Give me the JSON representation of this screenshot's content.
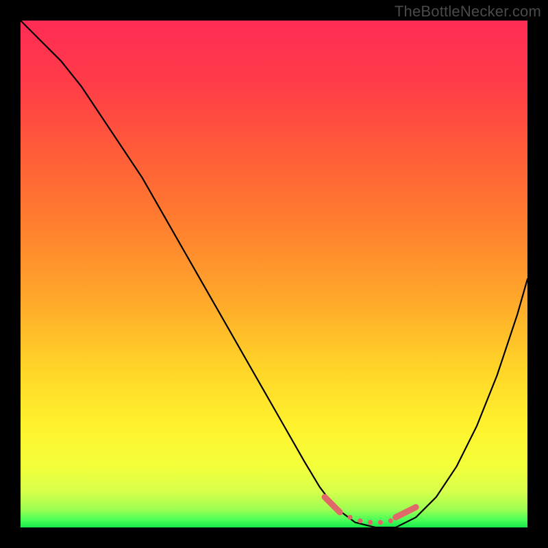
{
  "watermark": "TheBottleNecker.com",
  "chart_data": {
    "type": "line",
    "title": "",
    "xlabel": "",
    "ylabel": "",
    "xlim": [
      0,
      100
    ],
    "ylim": [
      0,
      100
    ],
    "series": [
      {
        "name": "curve",
        "color": "#000000",
        "x": [
          0,
          4,
          8,
          12,
          16,
          20,
          24,
          28,
          32,
          36,
          40,
          44,
          48,
          52,
          56,
          59,
          62,
          66,
          70,
          74,
          78,
          82,
          86,
          90,
          94,
          98,
          100
        ],
        "values": [
          100,
          96,
          92,
          87,
          81,
          75,
          69,
          62,
          55,
          48,
          41,
          34,
          27,
          20,
          13,
          8,
          4,
          1,
          0,
          0,
          2,
          6,
          12,
          20,
          30,
          42,
          49
        ]
      }
    ],
    "highlight": {
      "color": "#e16868",
      "segments": [
        {
          "x1": 60,
          "y1": 6,
          "x2": 63,
          "y2": 3
        },
        {
          "x1": 74,
          "y1": 2,
          "x2": 78,
          "y2": 4
        }
      ],
      "dots": [
        {
          "x": 65,
          "y": 2.0
        },
        {
          "x": 67,
          "y": 1.3
        },
        {
          "x": 69,
          "y": 1.0
        },
        {
          "x": 71,
          "y": 1.0
        },
        {
          "x": 73,
          "y": 1.3
        }
      ]
    },
    "gradient_stops": [
      {
        "offset": 0.0,
        "color": "#ff2c55"
      },
      {
        "offset": 0.12,
        "color": "#ff3b48"
      },
      {
        "offset": 0.25,
        "color": "#ff5a3a"
      },
      {
        "offset": 0.4,
        "color": "#ff7e2f"
      },
      {
        "offset": 0.55,
        "color": "#ffa82a"
      },
      {
        "offset": 0.68,
        "color": "#ffd328"
      },
      {
        "offset": 0.8,
        "color": "#fff22d"
      },
      {
        "offset": 0.88,
        "color": "#f3ff3a"
      },
      {
        "offset": 0.93,
        "color": "#d6ff4c"
      },
      {
        "offset": 0.965,
        "color": "#9cff52"
      },
      {
        "offset": 0.985,
        "color": "#4bff58"
      },
      {
        "offset": 1.0,
        "color": "#17e84d"
      }
    ]
  }
}
